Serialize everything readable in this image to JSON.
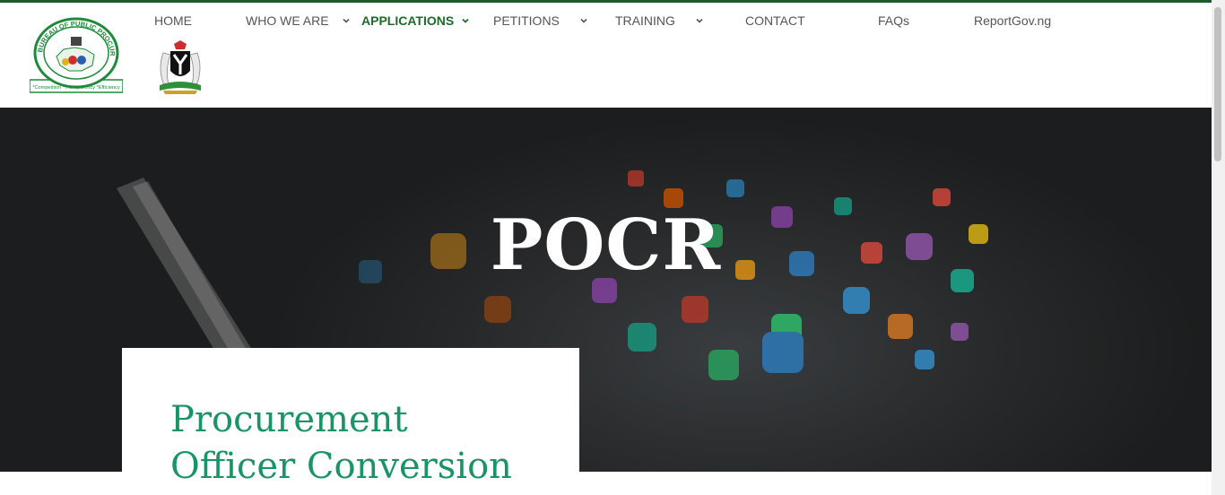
{
  "header": {
    "logo_bpp": {
      "ring_text": "BUREAU OF PUBLIC PROCUREMENT",
      "motto": "*Competition *Transparency *Efficiency"
    },
    "nav": [
      {
        "label": "HOME",
        "has_dropdown": false,
        "active": false
      },
      {
        "label": "WHO WE ARE",
        "has_dropdown": true,
        "active": false
      },
      {
        "label": "APPLICATIONS",
        "has_dropdown": true,
        "active": true
      },
      {
        "label": "PETITIONS",
        "has_dropdown": true,
        "active": false
      },
      {
        "label": "TRAINING",
        "has_dropdown": true,
        "active": false
      },
      {
        "label": "CONTACT",
        "has_dropdown": false,
        "active": false
      },
      {
        "label": "FAQs",
        "has_dropdown": false,
        "active": false
      },
      {
        "label": "ReportGov.ng",
        "has_dropdown": false,
        "active": false
      }
    ]
  },
  "hero": {
    "title": "POCR"
  },
  "card": {
    "title_line1": "Procurement",
    "title_line2": "Officer Conversion"
  },
  "colors": {
    "brand_green": "#1c6b2b",
    "card_title": "#1a9466",
    "nav_text": "#555555"
  },
  "icons": {
    "dropdown": "chevron-down-icon",
    "logo": "bpp-logo-icon",
    "coat_of_arms": "nigeria-coat-of-arms-icon"
  }
}
